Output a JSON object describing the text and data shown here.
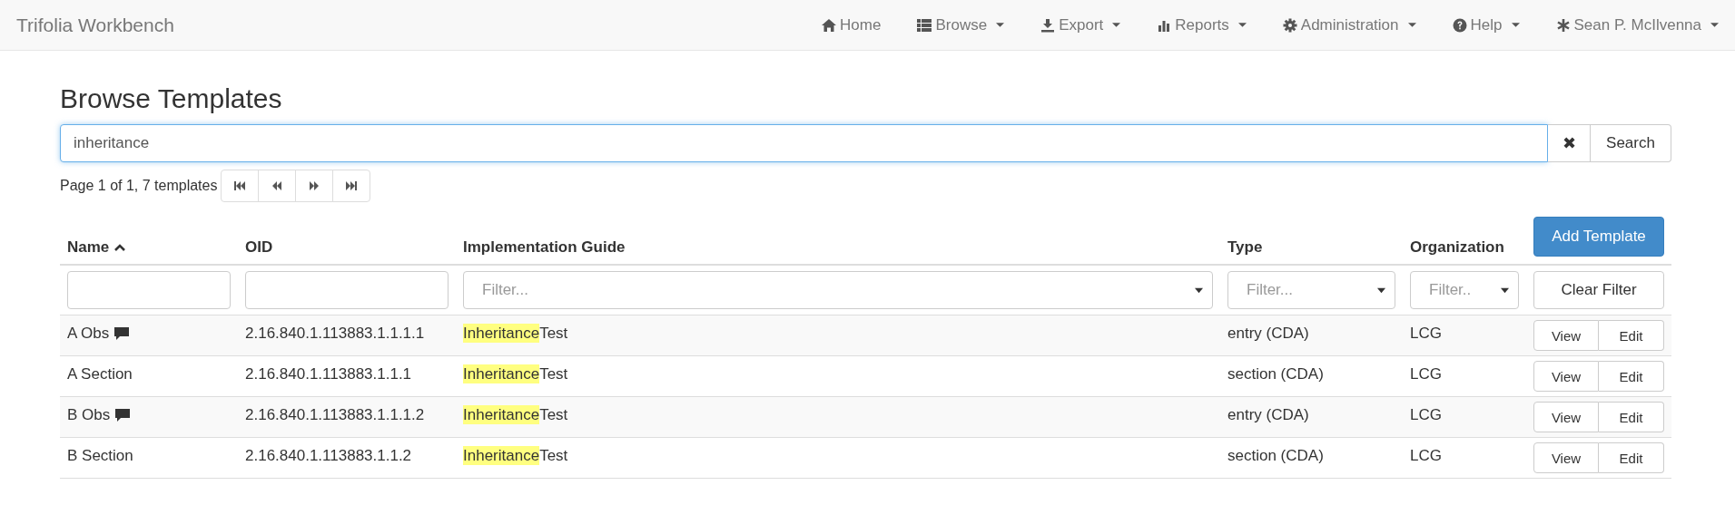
{
  "navbar": {
    "brand": "Trifolia Workbench",
    "items": [
      {
        "label": "Home",
        "dropdown": false
      },
      {
        "label": "Browse",
        "dropdown": true
      },
      {
        "label": "Export",
        "dropdown": true
      },
      {
        "label": "Reports",
        "dropdown": true
      },
      {
        "label": "Administration",
        "dropdown": true
      },
      {
        "label": "Help",
        "dropdown": true
      },
      {
        "label": "Sean P. McIlvenna",
        "dropdown": true
      }
    ]
  },
  "title": "Browse Templates",
  "search": {
    "value": "inheritance",
    "clear_icon": "✖",
    "button": "Search"
  },
  "pager": {
    "text": "Page 1 of 1, 7 templates"
  },
  "table": {
    "columns": [
      {
        "label": "Name",
        "sorted": true
      },
      {
        "label": "OID",
        "sorted": false
      },
      {
        "label": "Implementation Guide",
        "sorted": false
      },
      {
        "label": "Type",
        "sorted": false
      },
      {
        "label": "Organization",
        "sorted": false
      }
    ],
    "add_button": "Add Template",
    "filters": [
      {
        "kind": "text"
      },
      {
        "kind": "text"
      },
      {
        "kind": "select",
        "placeholder": "Filter..."
      },
      {
        "kind": "select",
        "placeholder": "Filter..."
      },
      {
        "kind": "select",
        "placeholder": "Filter.."
      }
    ],
    "clear_filter": "Clear Filter",
    "rows": [
      {
        "name": "A Obs",
        "has_comment": true,
        "oid": "2.16.840.1.113883.1.1.1.1",
        "ig_match": "Inheritance",
        "ig_rest": "Test",
        "type": "entry (CDA)",
        "org": "LCG",
        "view": "View",
        "edit": "Edit"
      },
      {
        "name": "A Section",
        "has_comment": false,
        "oid": "2.16.840.1.113883.1.1.1",
        "ig_match": "Inheritance",
        "ig_rest": "Test",
        "type": "section (CDA)",
        "org": "LCG",
        "view": "View",
        "edit": "Edit"
      },
      {
        "name": "B Obs",
        "has_comment": true,
        "oid": "2.16.840.1.113883.1.1.1.2",
        "ig_match": "Inheritance",
        "ig_rest": "Test",
        "type": "entry (CDA)",
        "org": "LCG",
        "view": "View",
        "edit": "Edit"
      },
      {
        "name": "B Section",
        "has_comment": false,
        "oid": "2.16.840.1.113883.1.1.2",
        "ig_match": "Inheritance",
        "ig_rest": "Test",
        "type": "section (CDA)",
        "org": "LCG",
        "view": "View",
        "edit": "Edit"
      }
    ]
  }
}
